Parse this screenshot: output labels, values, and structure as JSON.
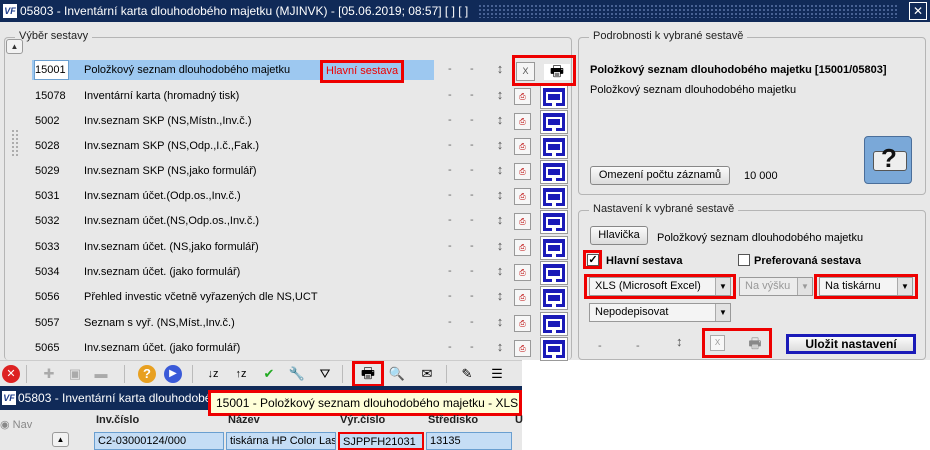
{
  "window": {
    "title": "05803 - Inventární karta dlouhodobého majetku (MJINVK) - [05.06.2019; 08:57]  [ ]  [ ]",
    "logo": "VF",
    "close": "✕"
  },
  "left": {
    "group_label": "Výběr sestavy",
    "rows": [
      {
        "code": "15001",
        "name": "Položkový seznam dlouhodobého majetku"
      },
      {
        "code": "15078",
        "name": "Inventární karta (hromadný tisk)"
      },
      {
        "code": "5002",
        "name": "Inv.seznam SKP (NS,Místn.,Inv.č.)"
      },
      {
        "code": "5028",
        "name": "Inv.seznam SKP (NS,Odp.,I.č.,Fak.)"
      },
      {
        "code": "5029",
        "name": "Inv.seznam SKP (NS,jako formulář)"
      },
      {
        "code": "5031",
        "name": "Inv.seznam účet.(Odp.os.,Inv.č.)"
      },
      {
        "code": "5032",
        "name": "Inv.seznam účet.(NS,Odp.os.,Inv.č.)"
      },
      {
        "code": "5033",
        "name": "Inv.seznam účet. (NS,jako formulář)"
      },
      {
        "code": "5034",
        "name": "Inv.seznam účet. (jako formulář)"
      },
      {
        "code": "5056",
        "name": "Přehled investic včetně vyřazených dle NS,UCT"
      },
      {
        "code": "5057",
        "name": "Seznam s vyř. (NS,Míst.,Inv.č.)"
      },
      {
        "code": "5065",
        "name": "Inv.seznam účet. (jako formulář)"
      }
    ],
    "main_label": "Hlavní sestava",
    "dash": "-"
  },
  "right": {
    "detail_label": "Podrobnosti k vybrané sestavě",
    "detail_title": "Položkový seznam dlouhodobého majetku [15001/05803]",
    "detail_sub": "Položkový seznam dlouhodobého majetku",
    "limit_button": "Omezení počtu záznamů",
    "limit_count": "10 000",
    "settings_label": "Nastavení k vybrané sestavě",
    "header_button": "Hlavička",
    "header_value": "Položkový seznam dlouhodobého majetku",
    "main_check_label": "Hlavní sestava",
    "pref_check_label": "Preferovaná sestava",
    "format_value": "XLS (Microsoft Excel)",
    "orient_value": "Na výšku",
    "output_value": "Na tiskárnu",
    "sign_value": "Nepodepisovat",
    "save_button": "Uložit nastavení",
    "dash": "-"
  },
  "second_window": {
    "title": "05803 - Inventární karta dlouhodobé",
    "tooltip": "15001 - Položkový seznam dlouhodobého majetku - XLS",
    "nav": "Nav",
    "columns": [
      "Inv.číslo",
      "Název",
      "Výr.číslo",
      "Středisko",
      "U"
    ],
    "row": [
      "C2-03000124/000",
      "tiskárna HP Color Las",
      "SJPPFH21031",
      "13135",
      ""
    ]
  }
}
